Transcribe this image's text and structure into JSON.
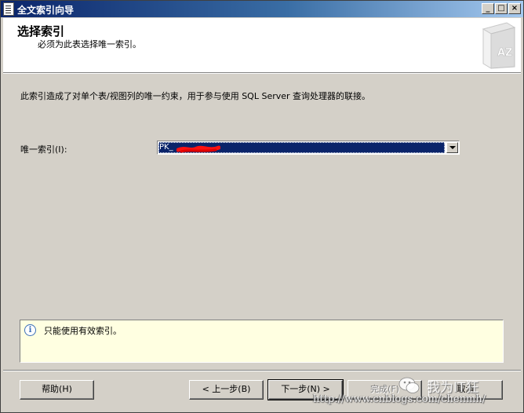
{
  "window": {
    "title": "全文索引向导",
    "controls": {
      "minimize": "_",
      "maximize": "□",
      "close": "×"
    }
  },
  "header": {
    "title": "选择索引",
    "subtitle": "必须为此表选择唯一索引。",
    "icon": "az-book-icon"
  },
  "body": {
    "description": "此索引造成了对单个表/视图列的唯一约束，用于参与使用 SQL Server 查询处理器的联接。",
    "unique_index_label": "唯一索引(I):",
    "unique_index_value": "PK_",
    "unique_index_redacted": true
  },
  "info": {
    "icon": "info-icon",
    "text": "只能使用有效索引。"
  },
  "buttons": {
    "help": "帮助(H)",
    "back": "< 上一步(B)",
    "next": "下一步(N) >",
    "finish": "完成(F)",
    "cancel": "取消"
  },
  "watermark": {
    "wechat_name": "我为IT狂",
    "url": "http://www.cnblogs.com/chenmh/"
  },
  "colors": {
    "titlebar_start": "#0a246a",
    "titlebar_end": "#a6caf0",
    "selection": "#0a246a",
    "info_background": "#ffffe1",
    "dialog_face": "#d4d0c8",
    "redaction": "#ff0000"
  }
}
